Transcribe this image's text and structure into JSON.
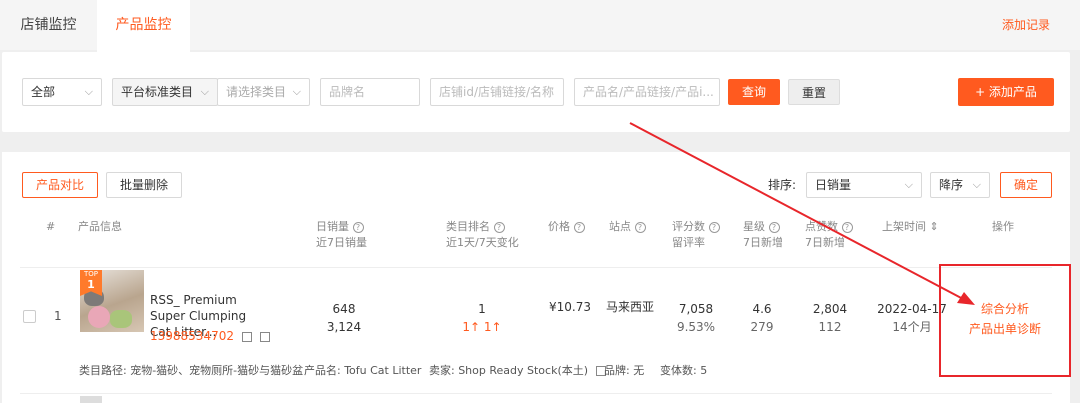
{
  "tabs": [
    {
      "label": "店铺监控",
      "active": false
    },
    {
      "label": "产品监控",
      "active": true
    }
  ],
  "add_record": "添加记录",
  "filters": {
    "scope": "全部",
    "category_type": "平台标准类目",
    "category_placeholder": "请选择类目",
    "brand_placeholder": "品牌名",
    "store_placeholder": "店铺id/店铺链接/名称",
    "product_placeholder": "产品名/产品链接/产品i...",
    "query": "查询",
    "reset": "重置",
    "add_product": "+ 添加产品"
  },
  "toolbar": {
    "compare": "产品对比",
    "bulk_delete": "批量删除",
    "sort_label": "排序:",
    "sort_field": "日销量",
    "sort_order": "降序",
    "confirm": "确定"
  },
  "columns": [
    {
      "title": "#",
      "sub": ""
    },
    {
      "title": "产品信息",
      "sub": ""
    },
    {
      "title": "日销量",
      "sub": "近7日销量"
    },
    {
      "title": "类目排名",
      "sub": "近1天/7天变化"
    },
    {
      "title": "价格",
      "sub": ""
    },
    {
      "title": "站点",
      "sub": ""
    },
    {
      "title": "评分数",
      "sub": "留评率"
    },
    {
      "title": "星级",
      "sub": "7日新增"
    },
    {
      "title": "点赞数",
      "sub": "7日新增"
    },
    {
      "title": "上架时间",
      "sub": ""
    },
    {
      "title": "操作",
      "sub": ""
    }
  ],
  "rows": [
    {
      "index": "1",
      "badge_top": "TOP",
      "badge_num": "1",
      "name": "RSS_ Premium Super Clumping Cat Litter...",
      "id": "13988534702",
      "daily_sales": "648",
      "sales_7d": "3,124",
      "rank": "1",
      "rank_change": "1↑ 1↑",
      "price": "¥10.73",
      "site": "马来西亚",
      "ratings": "7,058",
      "review_rate": "9.53%",
      "stars": "4.6",
      "stars_new": "279",
      "likes": "2,804",
      "likes_new": "112",
      "listed_date": "2022-04-17",
      "listed_age": "14个月",
      "action_analysis": "综合分析",
      "action_diagnosis": "产品出单诊断",
      "category_path": "类目路径: 宠物-猫砂、宠物厕所-猫砂与猫砂盆",
      "product_name": "产品名: Tofu Cat Litter",
      "seller": "卖家: Shop Ready Stock(本土)",
      "brand": "品牌: 无",
      "variants": "变体数: 5"
    }
  ]
}
